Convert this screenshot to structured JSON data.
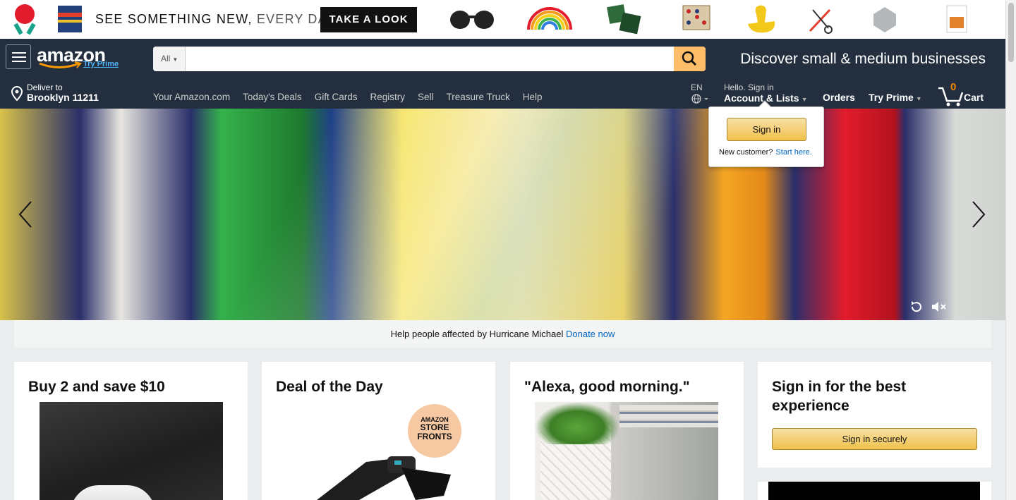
{
  "promo": {
    "tagline_main": "SEE SOMETHING NEW,",
    "tagline_light": "EVERY DAY.",
    "cta": "TAKE A LOOK"
  },
  "header": {
    "logo_text": "amazon",
    "logo_sub": "Try Prime",
    "search_category": "All",
    "search_value": "",
    "discover": "Discover small & medium businesses",
    "deliver_line1": "Deliver to",
    "deliver_line2": "Brooklyn 11211",
    "nav_links": [
      "Your Amazon.com",
      "Today's Deals",
      "Gift Cards",
      "Registry",
      "Sell",
      "Treasure Truck",
      "Help"
    ],
    "language": "EN",
    "account_line1": "Hello. Sign in",
    "account_line2": "Account & Lists",
    "orders": "Orders",
    "try_prime": "Try Prime",
    "cart_count": "0",
    "cart_label": "Cart"
  },
  "flyout": {
    "sign_in": "Sign in",
    "new_customer": "New customer?",
    "start_here": "Start here."
  },
  "notice": {
    "text": "Help people affected by Hurricane Michael",
    "link": "Donate now"
  },
  "cards": {
    "c1_title": "Buy 2 and save $10",
    "c2_title": "Deal of the Day",
    "c2_badge_top": "AMAZON",
    "c2_badge_mid": "STORE",
    "c2_badge_bot": "FRONTS",
    "c3_title": "\"Alexa, good morning.\"",
    "c4_title": "Sign in for the best experience",
    "c4_button": "Sign in securely"
  },
  "colors": {
    "nav_bg": "#232f3e",
    "search_button": "#febd69",
    "link": "#0066c0",
    "cart_count": "#f08804"
  }
}
